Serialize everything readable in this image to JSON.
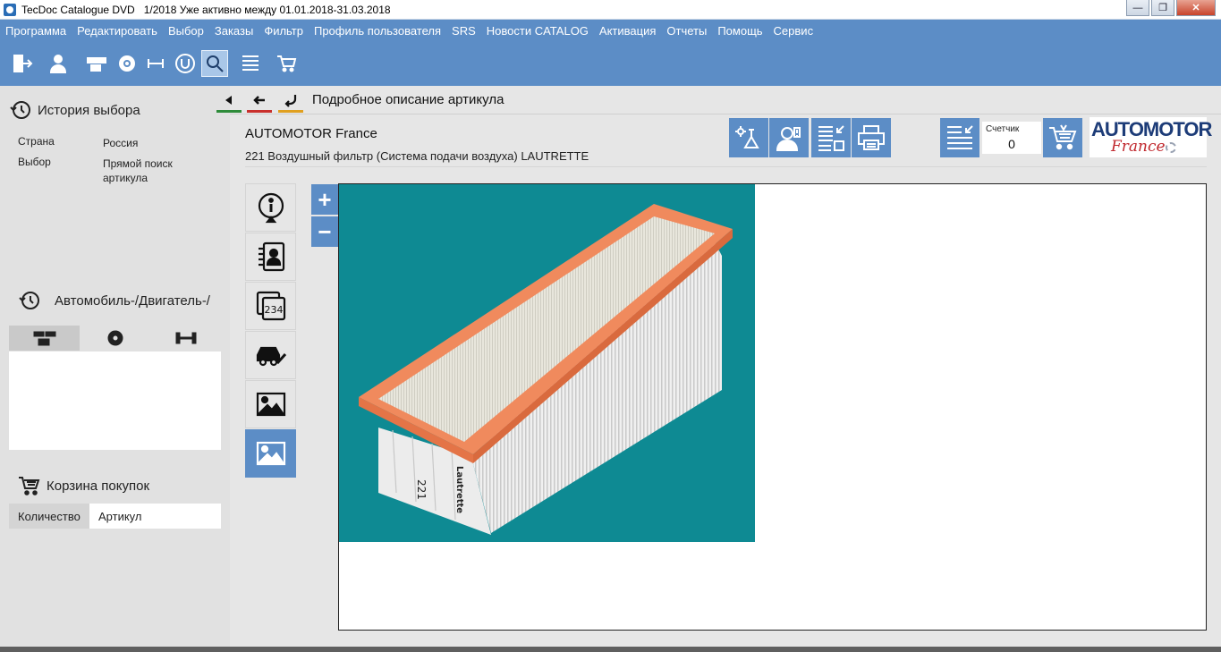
{
  "window": {
    "title": "TecDoc Catalogue DVD   1/2018 Уже активно между 01.01.2018-31.03.2018"
  },
  "menu": [
    "Программа",
    "Редактировать",
    "Выбор",
    "Заказы",
    "Фильтр",
    "Профиль пользователя",
    "SRS",
    "Новости CATALOG",
    "Активация",
    "Отчеты",
    "Помощь",
    "Сервис"
  ],
  "history": {
    "title": "История выбора",
    "rows": [
      {
        "label": "Страна",
        "value": "Россия"
      },
      {
        "label": "Выбор",
        "value": "Прямой поиск артикула"
      }
    ]
  },
  "vehicle": {
    "title": "Автомобиль-/Двигатель-/"
  },
  "cart": {
    "title": "Корзина покупок",
    "columns": [
      "Количество",
      "Артикул"
    ]
  },
  "page": {
    "title": "Подробное описание артикула",
    "supplier": "AUTOMOTOR France",
    "article": "221 Воздушный фильтр (Система подачи воздуха) LAUTRETTE"
  },
  "counter": {
    "label": "Счетчик",
    "value": "0"
  },
  "logo": {
    "line1": "AUTOMOTOR",
    "line2": "France"
  },
  "side_tabs": {
    "prices_number": "234"
  },
  "zoom": {
    "plus": "+",
    "minus": "−"
  },
  "product_image": {
    "part_number": "221",
    "brand_mark": "Lautrette"
  },
  "colors": {
    "accent": "#5c8dc6",
    "photo_background": "#0e8a93",
    "filter_frame": "#f08a5d"
  }
}
